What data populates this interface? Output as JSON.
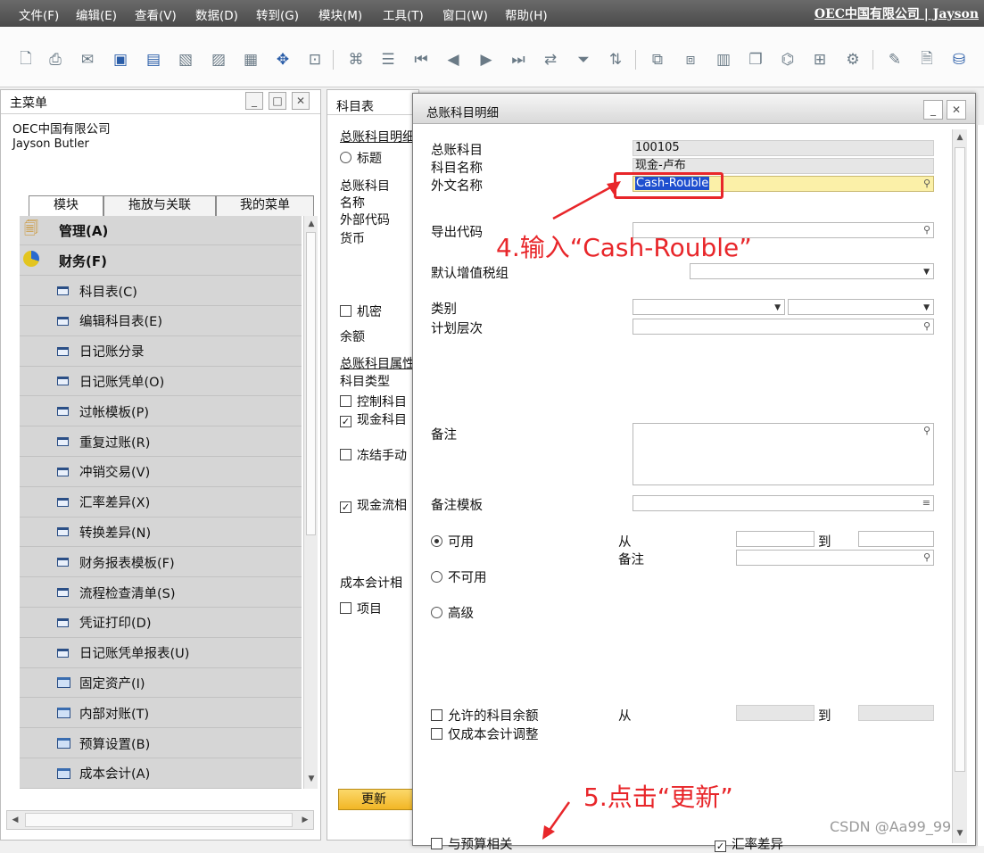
{
  "menubar": {
    "items": [
      "文件(F)",
      "编辑(E)",
      "查看(V)",
      "数据(D)",
      "转到(G)",
      "模块(M)",
      "工具(T)",
      "窗口(W)",
      "帮助(H)"
    ],
    "company": "OEC中国有限公司 | Jayson"
  },
  "toolbar": {
    "icons": [
      "preview-icon",
      "print-icon",
      "email-icon",
      "export-icon",
      "save-icon",
      "excel-icon",
      "word-icon",
      "pdf-icon",
      "launch-icon",
      "lock-icon",
      "find-icon",
      "list-icon",
      "first-record-icon",
      "previous-record-icon",
      "next-record-icon",
      "last-record-icon",
      "refresh-icon",
      "filter-icon",
      "sort-icon",
      "base-document-icon",
      "target-document-icon",
      "calculator-icon",
      "copy-icon",
      "tree-icon",
      "gross-profit-icon",
      "settings-icon",
      "edit-icon",
      "document-settings-icon",
      "user-icon"
    ]
  },
  "mainmenu": {
    "title": "主菜单",
    "company": "OEC中国有限公司",
    "user": "Jayson Butler",
    "tabs": [
      "模块",
      "拖放与关联",
      "我的菜单"
    ],
    "modules": [
      {
        "label": "管理(A)"
      },
      {
        "label": "财务(F)"
      }
    ],
    "items": [
      {
        "label": "科目表(C)",
        "type": "doc"
      },
      {
        "label": "编辑科目表(E)",
        "type": "doc"
      },
      {
        "label": "日记账分录",
        "type": "doc"
      },
      {
        "label": "日记账凭单(O)",
        "type": "doc"
      },
      {
        "label": "过帐模板(P)",
        "type": "doc"
      },
      {
        "label": "重复过账(R)",
        "type": "doc"
      },
      {
        "label": "冲销交易(V)",
        "type": "doc"
      },
      {
        "label": "汇率差异(X)",
        "type": "doc"
      },
      {
        "label": "转换差异(N)",
        "type": "doc"
      },
      {
        "label": "财务报表模板(F)",
        "type": "doc"
      },
      {
        "label": "流程检查清单(S)",
        "type": "doc"
      },
      {
        "label": "凭证打印(D)",
        "type": "doc"
      },
      {
        "label": "日记账凭单报表(U)",
        "type": "doc"
      },
      {
        "label": "固定资产(I)",
        "type": "folder"
      },
      {
        "label": "内部对账(T)",
        "type": "folder"
      },
      {
        "label": "预算设置(B)",
        "type": "folder"
      },
      {
        "label": "成本会计(A)",
        "type": "folder"
      }
    ]
  },
  "coa": {
    "title": "科目表",
    "section1": "总账科目明细",
    "title_radio": "标题",
    "gl_account": "总账科目",
    "name": "名称",
    "external_code": "外部代码",
    "currency": "货币",
    "confidential": "机密",
    "balance": "余额",
    "section2": "总账科目属性",
    "account_type": "科目类型",
    "control_account": "控制科目",
    "cash_account": "现金科目",
    "block_manual": "冻结手动",
    "cash_flow": "现金流相",
    "cost_accounting": "成本会计相",
    "project": "项目",
    "update_button": "更新"
  },
  "dialog": {
    "title": "总账科目明细",
    "gl_account_label": "总账科目",
    "gl_account_value": "100105",
    "account_name_label": "科目名称",
    "account_name_value": "现金-卢布",
    "foreign_name_label": "外文名称",
    "foreign_name_value": "Cash-Rouble",
    "export_code_label": "导出代码",
    "default_vat_label": "默认增值税组",
    "category_label": "类别",
    "planning_level_label": "计划层次",
    "remarks_label": "备注",
    "remarks_template_label": "备注模板",
    "active_label": "可用",
    "inactive_label": "不可用",
    "advanced_label": "高级",
    "from_label": "从",
    "to_label": "到",
    "remark_label": "备注",
    "allowed_balance_label": "允许的科目余额",
    "cost_adjust_label": "仅成本会计调整",
    "budget_label": "与预算相关",
    "exchange_diff_label": "汇率差异",
    "from2_label": "从",
    "to2_label": "到"
  },
  "annotations": {
    "step4": "4.输入“Cash-Rouble”",
    "step5": "5.点击“更新”"
  },
  "watermark": "CSDN @Aa99_99",
  "colors": {
    "annotation": "#e8262a",
    "highlight_field": "#fbf0a8",
    "selection": "#1f4fcf",
    "menubar": "#5a5a5a"
  }
}
